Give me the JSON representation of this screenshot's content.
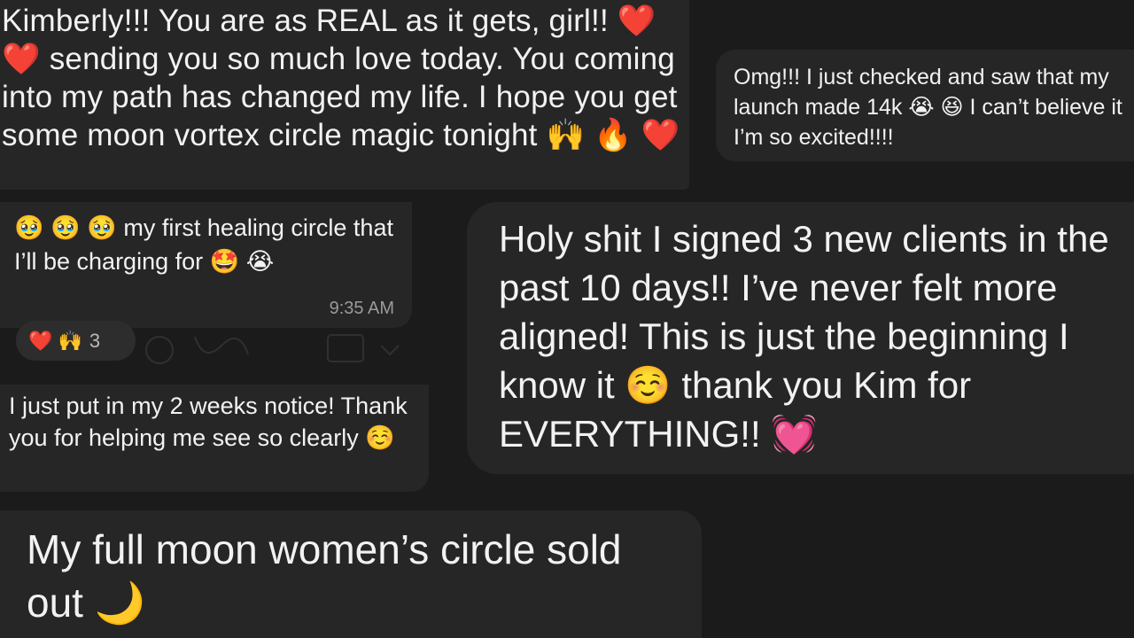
{
  "messages": {
    "m1": "Kimberly!!! You are as REAL as it gets, girl!! ❤️ ❤️ sending you so much love today. You coming into my path has changed my life. I hope you get some moon vortex circle magic tonight 🙌 🔥 ❤️",
    "m2": "Omg!!! I just checked and saw that my launch made 14k 😭 😆 I can’t believe it I’m so excited!!!!",
    "m3": "🥹 🥹 🥹 my first healing circle that I’ll be charging for 🤩 😭",
    "m3_time": "9:35 AM",
    "m3_reaction_emojis": "❤️ 🙌",
    "m3_reaction_count": "3",
    "m4": "Holy shit I signed 3 new clients in the past 10 days!! I’ve never felt more aligned! This is just the beginning I know it ☺️ thank you Kim for EVERYTHING!! 💓",
    "m5": "I just put in my 2 weeks notice! Thank you for helping me see so clearly ☺️",
    "m6": "My full moon women’s circle sold out 🌙"
  },
  "colors": {
    "background": "#1b1b1b",
    "bubble": "#262626",
    "text": "#f2f2f2",
    "timestamp": "#9a9a9a"
  }
}
